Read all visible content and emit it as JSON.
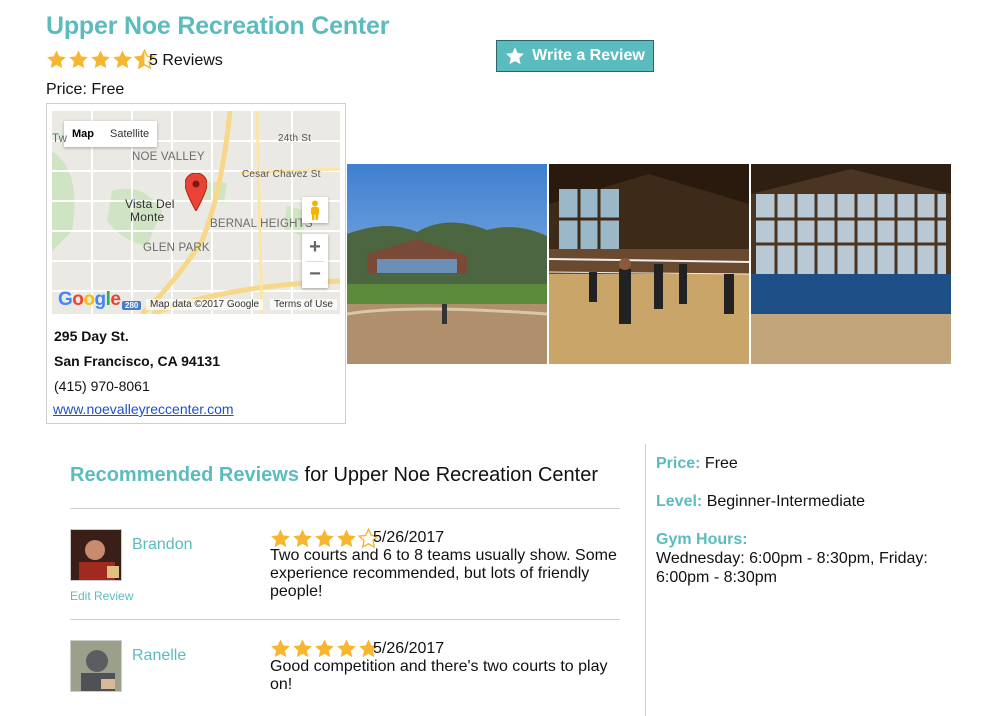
{
  "business": {
    "name": "Upper Noe Recreation Center",
    "rating": 4.5,
    "reviews_label": "5 Reviews",
    "price_label": "Price: Free",
    "write_review_label": "Write a Review"
  },
  "map": {
    "tab_map": "Map",
    "tab_satellite": "Satellite",
    "labels": [
      "NOE VALLEY",
      "Vista Del",
      "Monte",
      "BERNAL HEIGHTS",
      "GLEN PARK",
      "24th St",
      "Cesar Chavez St",
      "Tw"
    ],
    "google": "Google",
    "footer_data": "Map data ©2017 Google",
    "footer_terms": "Terms of Use",
    "zoom_in": "+",
    "zoom_out": "−",
    "highway": "280"
  },
  "contact": {
    "street": "295 Day St.",
    "city": "San Francisco, CA 94131",
    "phone": "(415) 970-8061",
    "website": "www.noevalleyreccenter.com"
  },
  "reviews_section": {
    "title_bold": "Recommended Reviews",
    "title_rest": " for Upper Noe Recreation Center",
    "reviews": [
      {
        "author": "Brandon",
        "rating": 4,
        "date": "5/26/2017",
        "text": "Two courts and 6 to 8 teams usually show. Some experience recommended, but lots of friendly people!",
        "edit_label": "Edit Review"
      },
      {
        "author": "Ranelle",
        "rating": 5,
        "date": "5/26/2017",
        "text": "Good competition and there's two courts to play on!"
      }
    ]
  },
  "sidebar": {
    "price_label": "Price:",
    "price_value": " Free",
    "level_label": "Level:",
    "level_value": " Beginner-Intermediate",
    "hours_label": "Gym Hours:",
    "hours_value": "Wednesday: 6:00pm - 8:30pm, Friday: 6:00pm - 8:30pm"
  },
  "colors": {
    "accent": "#5bbcbf",
    "star": "#f5b731",
    "link": "#2050c8"
  }
}
